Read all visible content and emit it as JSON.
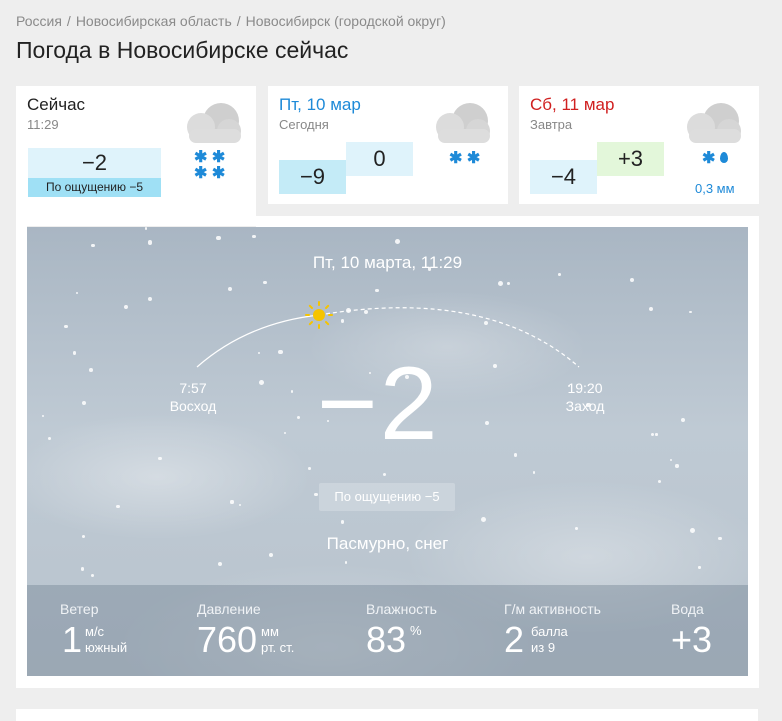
{
  "breadcrumb": {
    "items": [
      "Россия",
      "Новосибирская область",
      "Новосибирск (городской округ)"
    ],
    "separator": "/"
  },
  "title": "Погода в Новосибирске сейчас",
  "cards": {
    "now": {
      "title": "Сейчас",
      "time": "11:29",
      "temp": "−2",
      "feels": "По ощущению −5",
      "icon": "cloud-snow-icon"
    },
    "today": {
      "title": "Пт, 10 мар",
      "subtitle": "Сегодня",
      "temp_min": "−9",
      "temp_max": "0",
      "icon": "cloud-snow-icon",
      "title_color": "#1e8ad8"
    },
    "tomorrow": {
      "title": "Сб, 11 мар",
      "subtitle": "Завтра",
      "temp_min": "−4",
      "temp_max": "+3",
      "precip": "0,3 мм",
      "icon": "cloud-sleet-icon",
      "title_color": "#d02020"
    }
  },
  "hero": {
    "datetime": "Пт, 10 марта, 11:29",
    "sunrise_time": "7:57",
    "sunrise_label": "Восход",
    "sunset_time": "19:20",
    "sunset_label": "Заход",
    "temp": "−2",
    "feels": "По ощущению −5",
    "condition": "Пасмурно, снег",
    "sun_icon": "sun-icon"
  },
  "stats": {
    "wind": {
      "label": "Ветер",
      "value": "1",
      "unit1": "м/с",
      "unit2": "южный"
    },
    "pressure": {
      "label": "Давление",
      "value": "760",
      "unit1": "мм",
      "unit2": "рт. ст."
    },
    "humidity": {
      "label": "Влажность",
      "value": "83",
      "unit1": "%"
    },
    "geomagnetic": {
      "label": "Г/м активность",
      "value": "2",
      "unit1": "балла",
      "unit2": "из 9"
    },
    "water": {
      "label": "Вода",
      "value": "+3"
    }
  },
  "colors": {
    "accent_blue": "#1e8ad8",
    "accent_red": "#d02020",
    "cold_bg": "#dff3fb",
    "warm_bg": "#e3f7da",
    "feels_bg": "#9fe0f5"
  }
}
